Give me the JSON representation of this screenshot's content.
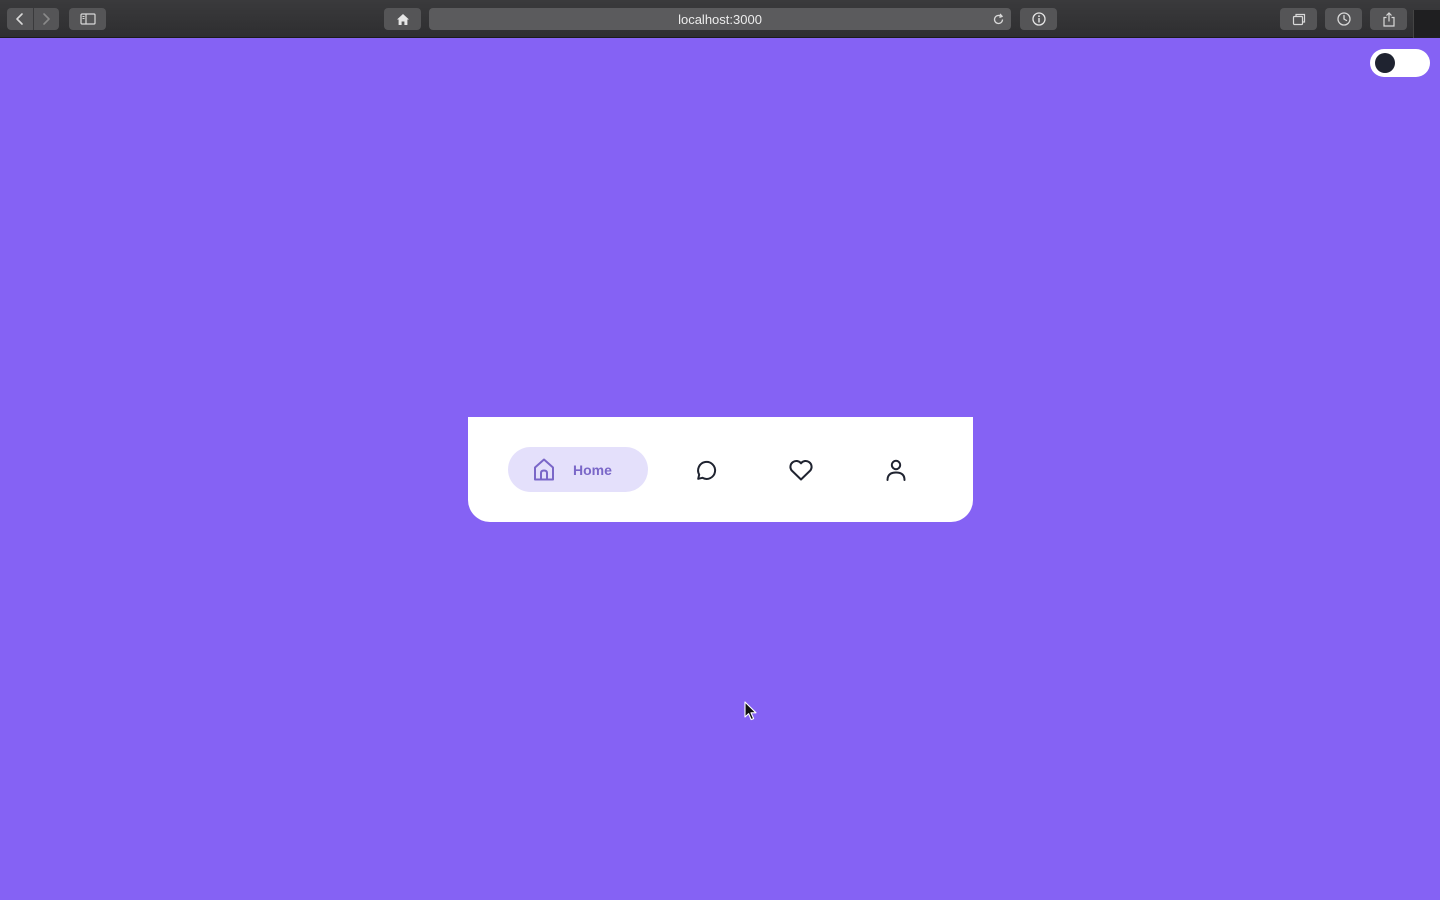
{
  "browser": {
    "url": "localhost:3000",
    "icons": {
      "back": "chevron-left-icon",
      "forward": "chevron-right-icon",
      "sidebar": "sidebar-icon",
      "home": "home-icon",
      "reload": "reload-icon",
      "info": "info-icon",
      "tabs": "tabs-icon",
      "history": "clock-icon",
      "share": "share-icon"
    }
  },
  "theme_toggle": {
    "state": "off",
    "knob_color": "#1f2330"
  },
  "nav": {
    "items": [
      {
        "id": "home",
        "label": "Home",
        "icon": "home-icon",
        "active": true
      },
      {
        "id": "chat",
        "label": "",
        "icon": "chat-bubble-icon",
        "active": false
      },
      {
        "id": "likes",
        "label": "",
        "icon": "heart-icon",
        "active": false
      },
      {
        "id": "profile",
        "label": "",
        "icon": "user-icon",
        "active": false
      }
    ]
  },
  "colors": {
    "background": "#8562f4",
    "card": "#ffffff",
    "active_pill": "#e4e0fb",
    "active_text": "#7a67c8",
    "icon": "#1f2330"
  }
}
